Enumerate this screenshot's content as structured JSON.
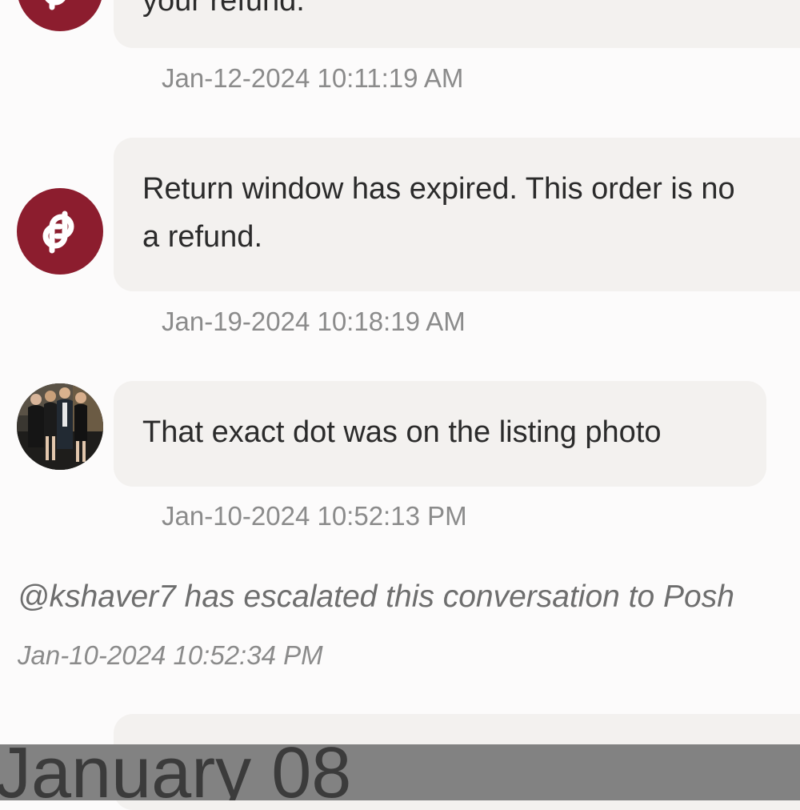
{
  "messages": [
    {
      "sender": "poshmark",
      "avatar_icon": "poshmark-logo-icon",
      "lines": [
        "your refund."
      ],
      "timestamp": "Jan-12-2024 10:11:19 AM"
    },
    {
      "sender": "poshmark",
      "avatar_icon": "poshmark-logo-icon",
      "lines": [
        "Return window has expired. This order is no",
        "a refund."
      ],
      "timestamp": "Jan-19-2024 10:18:19 AM"
    },
    {
      "sender": "user",
      "avatar_icon": "user-photo-avatar",
      "lines": [
        "That exact dot was on the listing photo"
      ],
      "timestamp": "Jan-10-2024 10:52:13 PM"
    }
  ],
  "system_event": {
    "text": "@kshaver7 has escalated this conversation to Posh",
    "timestamp": "Jan-10-2024 10:52:34 PM"
  },
  "date_header": "January 08",
  "colors": {
    "brand": "#8c1d2e",
    "bubble": "#f3f1ef",
    "background": "#fcfbfb",
    "timestamp": "#8b8b8b"
  }
}
